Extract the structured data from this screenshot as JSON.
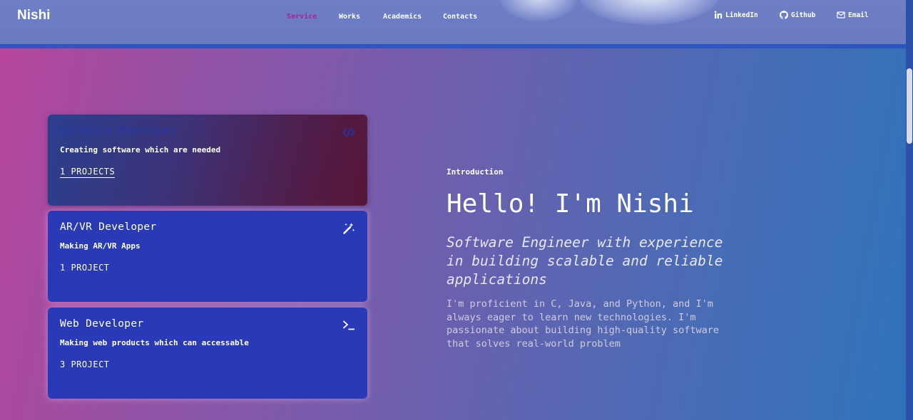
{
  "header": {
    "logo": "Nishi",
    "nav": [
      {
        "label": "Service",
        "active": true
      },
      {
        "label": "Works",
        "active": false
      },
      {
        "label": "Academics",
        "active": false
      },
      {
        "label": "Contacts",
        "active": false
      }
    ],
    "social": [
      {
        "label": "LinkedIn",
        "icon": "linkedin-icon"
      },
      {
        "label": "Github",
        "icon": "github-icon"
      },
      {
        "label": "Email",
        "icon": "email-icon"
      }
    ]
  },
  "services": [
    {
      "title": "Software Developer",
      "description": "Creating software which are needed",
      "count": "1 PROJECTS",
      "icon": "code-icon"
    },
    {
      "title": "AR/VR Developer",
      "description": "Making AR/VR Apps",
      "count": "1 PROJECT",
      "icon": "magic-wand-icon"
    },
    {
      "title": "Web Developer",
      "description": "Making web products which can accessable",
      "count": "3 PROJECT",
      "icon": "terminal-icon"
    }
  ],
  "intro": {
    "label": "Introduction",
    "title": "Hello! I'm Nishi",
    "subtitle": "Software Engineer with experience in building scalable and reliable applications",
    "body": "I'm proficient in C, Java, and Python, and I'm always eager to learn new technologies. I'm passionate about building high-quality software that solves real-world problem"
  },
  "colors": {
    "accent_active_nav": "#a91f9a",
    "card_bg": "#2a39b6",
    "header_bg": "#6f7fc6",
    "header_border": "#2f55c0"
  }
}
